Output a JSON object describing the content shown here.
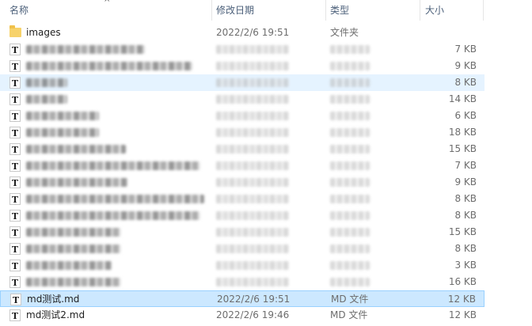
{
  "columns": {
    "name": "名称",
    "date": "修改日期",
    "type": "类型",
    "size": "大小"
  },
  "rows": [
    {
      "kind": "folder",
      "name": "images",
      "date": "2022/2/6 19:51",
      "type": "文件夹",
      "size": ""
    },
    {
      "kind": "doc-blurred",
      "name": "",
      "date": "",
      "type": "",
      "size": "7 KB"
    },
    {
      "kind": "doc-blurred",
      "name": "",
      "date": "",
      "type": "",
      "size": "9 KB"
    },
    {
      "kind": "doc-blurred",
      "name": "",
      "date": "",
      "type": "",
      "size": "8 KB"
    },
    {
      "kind": "doc-blurred",
      "name": "",
      "date": "",
      "type": "",
      "size": "14 KB"
    },
    {
      "kind": "doc-blurred",
      "name": "",
      "date": "",
      "type": "",
      "size": "6 KB"
    },
    {
      "kind": "doc-blurred",
      "name": "",
      "date": "",
      "type": "",
      "size": "18 KB"
    },
    {
      "kind": "doc-blurred",
      "name": "",
      "date": "",
      "type": "",
      "size": "15 KB"
    },
    {
      "kind": "doc-blurred",
      "name": "",
      "date": "",
      "type": "",
      "size": "7 KB"
    },
    {
      "kind": "doc-blurred",
      "name": "",
      "date": "",
      "type": "",
      "size": "9 KB"
    },
    {
      "kind": "doc-blurred",
      "name": "",
      "date": "",
      "type": "",
      "size": "8 KB"
    },
    {
      "kind": "doc-blurred",
      "name": "",
      "date": "",
      "type": "",
      "size": "8 KB"
    },
    {
      "kind": "doc-blurred",
      "name": "",
      "date": "",
      "type": "",
      "size": "15 KB"
    },
    {
      "kind": "doc-blurred",
      "name": "",
      "date": "",
      "type": "",
      "size": "8 KB"
    },
    {
      "kind": "doc-blurred",
      "name": "",
      "date": "",
      "type": "",
      "size": "3 KB"
    },
    {
      "kind": "doc-blurred",
      "name": "",
      "date": "",
      "type": "",
      "size": "16 KB"
    },
    {
      "kind": "doc",
      "name": "md测试.md",
      "date": "2022/2/6 19:51",
      "type": "MD 文件",
      "size": "12 KB"
    },
    {
      "kind": "doc",
      "name": "md测试2.md",
      "date": "2022/2/6 19:46",
      "type": "MD 文件",
      "size": "12 KB"
    }
  ],
  "icons": {
    "folder": "folder-icon",
    "doc": "text-document-icon",
    "doc_glyph": "T",
    "sort": "sort-ascending-icon",
    "sort_glyph": "^"
  },
  "colors": {
    "header_text": "#4c607a",
    "hover_bg": "#e5f3ff",
    "selected_bg": "#cce8ff",
    "selected_border": "#99d1ff",
    "folder": "#f7d26a"
  }
}
